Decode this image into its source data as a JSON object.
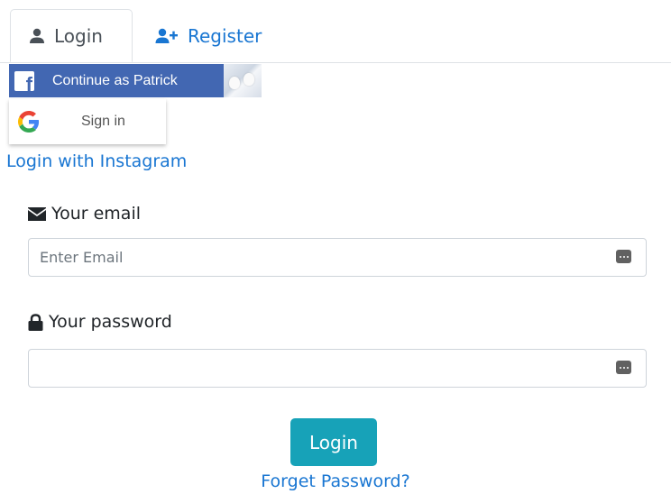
{
  "tabs": {
    "login_label": "Login",
    "register_label": "Register"
  },
  "social": {
    "facebook_label": "Continue as Patrick",
    "google_label": "Sign in",
    "instagram_label": "Login with Instagram"
  },
  "form": {
    "email_label": "Your email",
    "email_placeholder": "Enter Email",
    "email_value": "",
    "password_label": "Your password",
    "password_placeholder": "",
    "password_value": "",
    "submit_label": "Login",
    "forgot_label": "Forget Password?"
  },
  "colors": {
    "link": "#1976d2",
    "facebook": "#4267b2",
    "submit": "#17a2b8"
  },
  "icons": {
    "login_tab": "user-icon",
    "register_tab": "user-plus-icon",
    "email": "envelope-icon",
    "password": "lock-icon",
    "facebook": "facebook-icon",
    "google": "google-icon",
    "password_manager": "password-manager-icon"
  }
}
